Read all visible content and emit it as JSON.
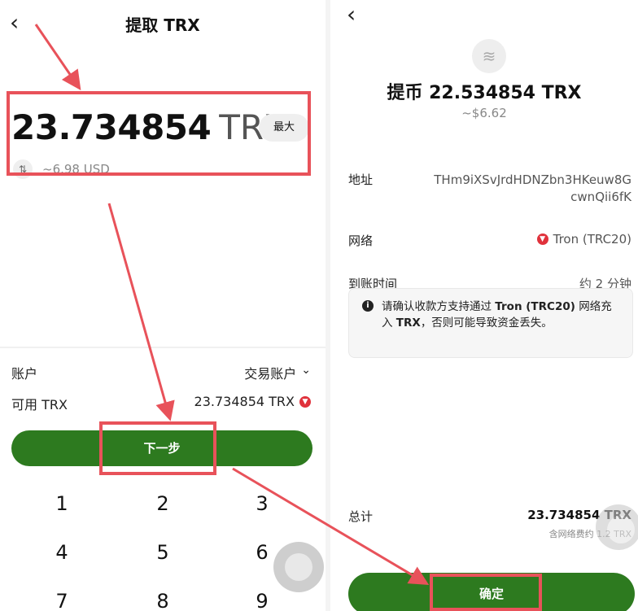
{
  "left": {
    "title": "提取 TRX",
    "back_glyph": "‹",
    "amount_value": "23.734854",
    "amount_unit": "TRX",
    "max_label": "最大",
    "swap_glyph": "⇅",
    "usd_value": "~6.98 USD",
    "account_label": "账户",
    "account_value": "交易账户",
    "account_chevron": "⌄",
    "available_label": "可用 TRX",
    "available_value": "23.734854 TRX",
    "next_label": "下一步",
    "keypad": [
      "1",
      "2",
      "3",
      "4",
      "5",
      "6",
      "7",
      "8",
      "9"
    ]
  },
  "right": {
    "back_glyph": "‹",
    "coin_glyph": "≋",
    "title": "提币 22.534854 TRX",
    "usd_value": "~$6.62",
    "address_label": "地址",
    "address_line1": "THm9iXSvJrdHDNZbn3HKeuw8G",
    "address_line2": "cwnQii6fK",
    "network_label": "网络",
    "network_value": "Tron (TRC20)",
    "arrival_label": "到账时间",
    "arrival_value": "约 2 分钟",
    "notice_icon": "i",
    "notice_part1": "请确认收款方支持通过 ",
    "notice_bold1": "Tron (TRC20)",
    "notice_part2": " 网络充入 ",
    "notice_bold2": "TRX",
    "notice_part3": "，否则可能导致资金丢失。",
    "total_label": "总计",
    "total_value": "23.734854 TRX",
    "fee_note": "含网络费约 1.2 TRX",
    "confirm_label": "确定"
  },
  "colors": {
    "accent_green": "#2d7a1f",
    "highlight_red": "#e8525a",
    "tron_red": "#e0323c"
  }
}
